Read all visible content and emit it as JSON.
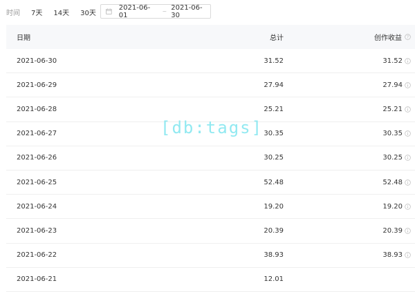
{
  "filter": {
    "label": "时间",
    "ranges": [
      "7天",
      "14天",
      "30天"
    ],
    "date_start": "2021-06-01",
    "date_separator": "~",
    "date_end": "2021-06-30",
    "icons": {
      "calendar": "calendar-icon"
    }
  },
  "table": {
    "headers": {
      "date": "日期",
      "total": "总计",
      "earnings": "创作收益"
    },
    "rows": [
      {
        "date": "2021-06-30",
        "total": "31.52",
        "earnings": "31.52"
      },
      {
        "date": "2021-06-29",
        "total": "27.94",
        "earnings": "27.94"
      },
      {
        "date": "2021-06-28",
        "total": "25.21",
        "earnings": "25.21"
      },
      {
        "date": "2021-06-27",
        "total": "30.35",
        "earnings": "30.35"
      },
      {
        "date": "2021-06-26",
        "total": "30.25",
        "earnings": "30.25"
      },
      {
        "date": "2021-06-25",
        "total": "52.48",
        "earnings": "52.48"
      },
      {
        "date": "2021-06-24",
        "total": "19.20",
        "earnings": "19.20"
      },
      {
        "date": "2021-06-23",
        "total": "20.39",
        "earnings": "20.39"
      },
      {
        "date": "2021-06-22",
        "total": "38.93",
        "earnings": "38.93"
      },
      {
        "date": "2021-06-21",
        "total": "12.01",
        "earnings": ""
      }
    ]
  },
  "watermark": "[db:tags]",
  "colors": {
    "header_bg": "#f7f8fa",
    "border": "#efefef",
    "watermark": "#7fe6ef",
    "muted": "#999999"
  }
}
